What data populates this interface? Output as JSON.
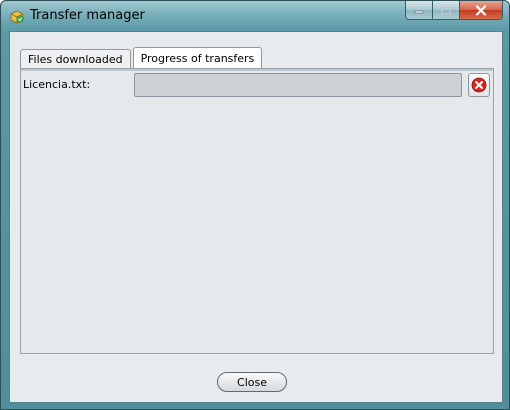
{
  "window": {
    "title": "Transfer manager",
    "icon": "transfer-manager-app-icon"
  },
  "caption_buttons": {
    "minimize_icon": "minimize-icon",
    "maximize_icon": "maximize-icon",
    "close_icon": "close-icon"
  },
  "tabs": [
    {
      "label": "Files downloaded",
      "selected": false
    },
    {
      "label": "Progress of transfers",
      "selected": true
    }
  ],
  "transfers": [
    {
      "file_label": "Licencia.txt:",
      "progress": 0,
      "cancel_icon": "cancel-x-icon"
    }
  ],
  "footer": {
    "close_label": "Close"
  },
  "colors": {
    "frame": "#5a98a6",
    "panel_bg": "#e6e9ec",
    "progress_track": "#cdd2d7",
    "cancel_red": "#d9261c"
  }
}
